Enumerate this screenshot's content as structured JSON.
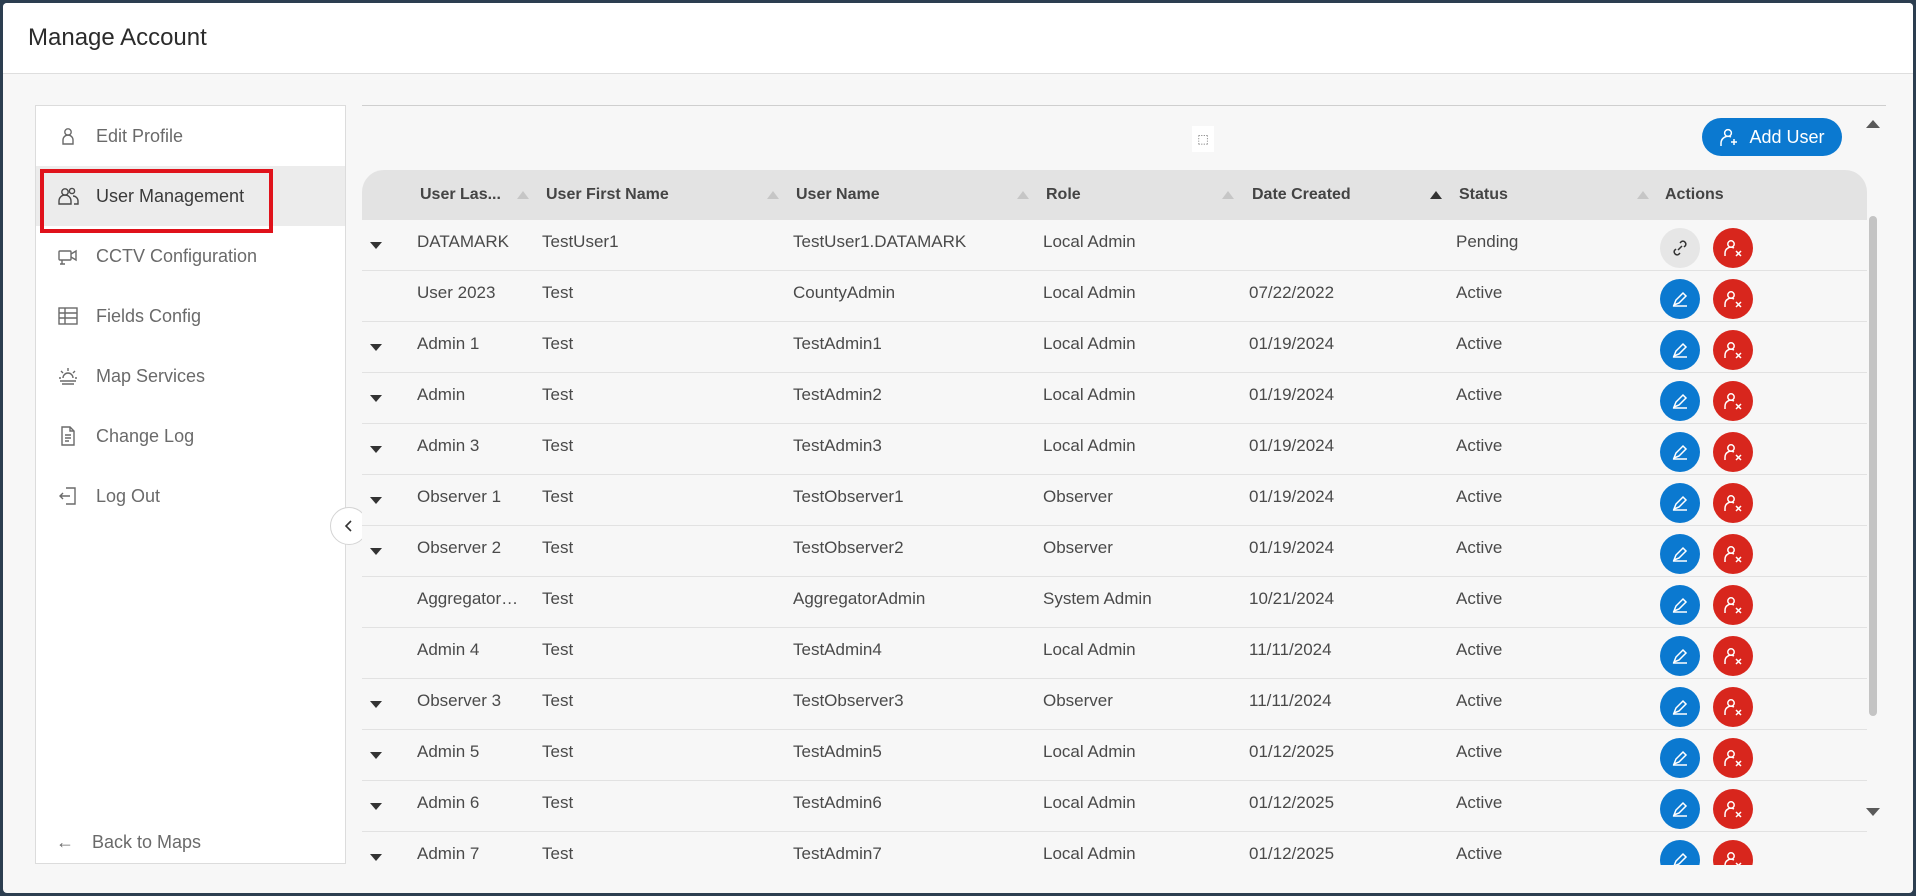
{
  "window": {
    "title": "Manage Account"
  },
  "sidebar": {
    "items": [
      {
        "label": "Edit Profile",
        "icon": "person-icon"
      },
      {
        "label": "User Management",
        "icon": "users-icon"
      },
      {
        "label": "CCTV Configuration",
        "icon": "camera-icon"
      },
      {
        "label": "Fields Config",
        "icon": "table-icon"
      },
      {
        "label": "Map Services",
        "icon": "map-services-icon"
      },
      {
        "label": "Change Log",
        "icon": "document-icon"
      },
      {
        "label": "Log Out",
        "icon": "logout-icon"
      }
    ],
    "active": "User Management",
    "back_label": "Back to Maps"
  },
  "toolbar": {
    "add_user_label": "Add User"
  },
  "table": {
    "columns": [
      "User Las...",
      "User First Name",
      "User Name",
      "Role",
      "Date Created",
      "Status",
      "Actions"
    ],
    "sorted_column": "Date Created",
    "rows": [
      {
        "last": "DATAMARK",
        "first": "TestUser1",
        "username": "TestUser1.DATAMARK",
        "role": "Local Admin",
        "date": "",
        "status": "Pending"
      },
      {
        "last": "User 2023",
        "first": "Test",
        "username": "CountyAdmin",
        "role": "Local Admin",
        "date": "07/22/2022",
        "status": "Active"
      },
      {
        "last": "Admin 1",
        "first": "Test",
        "username": "TestAdmin1",
        "role": "Local Admin",
        "date": "01/19/2024",
        "status": "Active"
      },
      {
        "last": "Admin",
        "first": "Test",
        "username": "TestAdmin2",
        "role": "Local Admin",
        "date": "01/19/2024",
        "status": "Active"
      },
      {
        "last": "Admin 3",
        "first": "Test",
        "username": "TestAdmin3",
        "role": "Local Admin",
        "date": "01/19/2024",
        "status": "Active"
      },
      {
        "last": "Observer 1",
        "first": "Test",
        "username": "TestObserver1",
        "role": "Observer",
        "date": "01/19/2024",
        "status": "Active"
      },
      {
        "last": "Observer 2",
        "first": "Test",
        "username": "TestObserver2",
        "role": "Observer",
        "date": "01/19/2024",
        "status": "Active"
      },
      {
        "last": "Aggregator…",
        "first": "Test",
        "username": "AggregatorAdmin",
        "role": "System Admin",
        "date": "10/21/2024",
        "status": "Active"
      },
      {
        "last": "Admin 4",
        "first": "Test",
        "username": "TestAdmin4",
        "role": "Local Admin",
        "date": "11/11/2024",
        "status": "Active"
      },
      {
        "last": "Observer 3",
        "first": "Test",
        "username": "TestObserver3",
        "role": "Observer",
        "date": "11/11/2024",
        "status": "Active"
      },
      {
        "last": "Admin 5",
        "first": "Test",
        "username": "TestAdmin5",
        "role": "Local Admin",
        "date": "01/12/2025",
        "status": "Active"
      },
      {
        "last": "Admin 6",
        "first": "Test",
        "username": "TestAdmin6",
        "role": "Local Admin",
        "date": "01/12/2025",
        "status": "Active"
      },
      {
        "last": "Admin 7",
        "first": "Test",
        "username": "TestAdmin7",
        "role": "Local Admin",
        "date": "01/12/2025",
        "status": "Active"
      }
    ]
  },
  "colors": {
    "accent": "#0b79d0",
    "danger": "#d8261d",
    "highlight": "#e0121b"
  }
}
